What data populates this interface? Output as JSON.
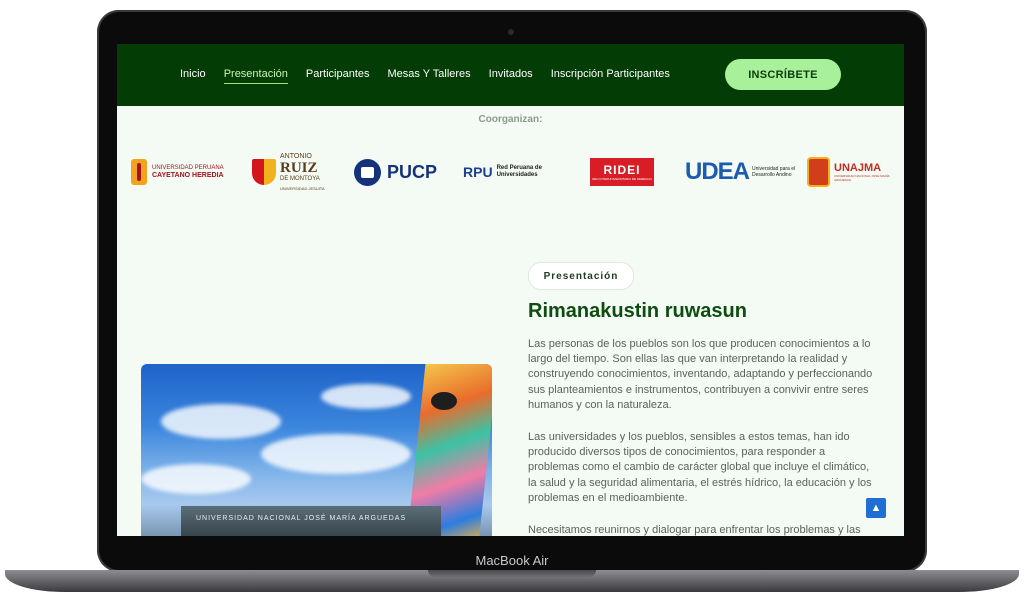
{
  "device": {
    "label": "MacBook Air"
  },
  "nav": {
    "items": [
      {
        "label": "Inicio"
      },
      {
        "label": "Presentación"
      },
      {
        "label": "Participantes"
      },
      {
        "label": "Mesas Y Talleres"
      },
      {
        "label": "Invitados"
      },
      {
        "label": "Inscripción Participantes"
      }
    ],
    "cta": "INSCRÍBETE"
  },
  "sponsors": {
    "title": "Coorganizan:",
    "logos": [
      {
        "name": "UNIVERSIDAD PERUANA CAYETANO HEREDIA",
        "line1": "UNIVERSIDAD PERUANA",
        "line2": "CAYETANO HEREDIA"
      },
      {
        "name": "ANTONIO RUIZ DE MONTOYA",
        "line1": "ANTONIO",
        "line2": "RUIZ",
        "line3": "DE MONTOYA",
        "line4": "UNIVERSIDAD JESUITA"
      },
      {
        "name": "PUCP"
      },
      {
        "name": "RPU Red Peruana de Universidades",
        "abbr": "RPU",
        "line1": "Red Peruana de",
        "line2": "Universidades"
      },
      {
        "name": "RIDEI",
        "sub": "RED INTERUNIVERSITARIA DE DERECHO"
      },
      {
        "name": "UDEA Universidad para el Desarrollo Andino",
        "line1": "Universidad para el",
        "line2": "Desarrollo Andino"
      },
      {
        "name": "UNAJMA",
        "sub": "UNIVERSIDAD NACIONAL JOSÉ MARÍA ARGUEDAS"
      }
    ]
  },
  "presentation": {
    "tag": "Presentación",
    "title": "Rimanakustin ruwasun",
    "paragraphs": [
      "Las personas de los pueblos son los que producen conocimientos a lo largo del tiempo. Son ellas las que van interpretando la realidad y construyendo conocimientos, inventando, adaptando y perfeccionando sus planteamientos e instrumentos, contribuyen a convivir entre seres humanos y con la naturaleza.",
      "Las universidades y los pueblos, sensibles a estos temas, han ido producido diversos tipos de conocimientos, para responder a problemas como el cambio de carácter global que incluye el climático, la salud y la seguridad alimentaria, el estrés hídrico, la educación y los problemas en el medioambiente.",
      "Necesitamos reunirnos y dialogar para enfrentar los problemas y las"
    ],
    "image_sign": "UNIVERSIDAD NACIONAL JOSÉ MARÍA ARGUEDAS"
  },
  "colors": {
    "header_bg": "#033c05",
    "cta_bg": "#a8f09a",
    "title_green": "#0d4d10",
    "page_bg": "#f4fbf4"
  },
  "icons": {
    "scroll_top": "chevron-up-icon"
  }
}
